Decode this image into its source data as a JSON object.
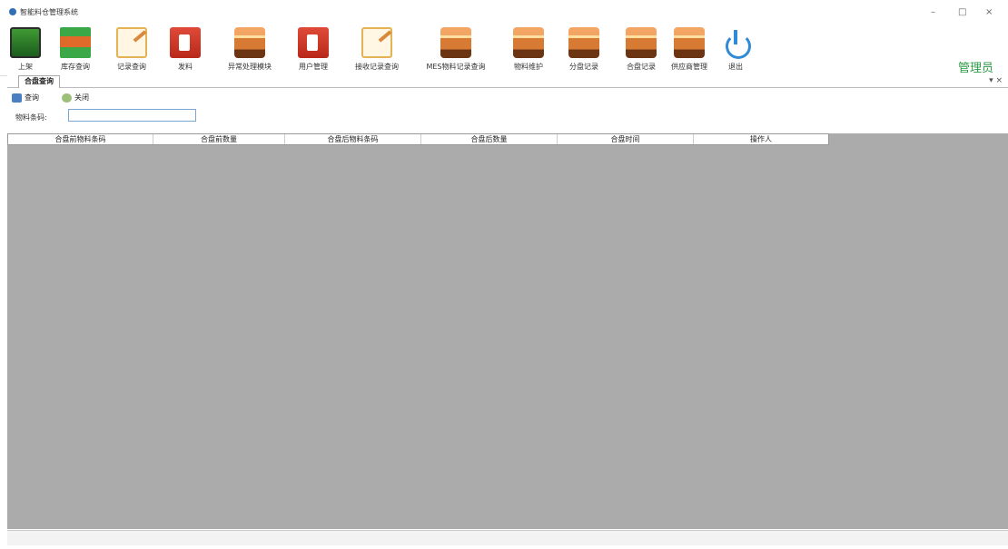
{
  "window": {
    "title": "智能料仓管理系统",
    "minimize": "–",
    "maximize": "□",
    "close": "×"
  },
  "toolbar": {
    "buttons": [
      {
        "label": "上架",
        "icon": "upload-icon"
      },
      {
        "label": "库存查询",
        "icon": "inventory-icon"
      },
      {
        "label": "记录查询",
        "icon": "notepad-icon"
      },
      {
        "label": "发料",
        "icon": "issue-icon"
      },
      {
        "label": "异常处理模块",
        "icon": "box-icon"
      },
      {
        "label": "用户管理",
        "icon": "user-icon"
      },
      {
        "label": "接收记录查询",
        "icon": "notepad-icon"
      },
      {
        "label": "MES物料记录查询",
        "icon": "box-icon"
      },
      {
        "label": "物料维护",
        "icon": "box-icon"
      },
      {
        "label": "分盘记录",
        "icon": "box-icon"
      },
      {
        "label": "合盘记录",
        "icon": "box-icon"
      },
      {
        "label": "供应商管理",
        "icon": "box-icon"
      },
      {
        "label": "退出",
        "icon": "power-icon"
      }
    ],
    "user_label": "管理员"
  },
  "tabs": [
    {
      "label": "合盘查询",
      "active": true
    }
  ],
  "tab_close": "▾ ×",
  "query": {
    "search_label": "查询",
    "close_label": "关闭",
    "material_label": "物料条码:",
    "material_value": ""
  },
  "grid": {
    "columns": [
      "合盘前物料条码",
      "合盘前数量",
      "合盘后物料条码",
      "合盘后数量",
      "合盘时间",
      "操作人"
    ],
    "rows": []
  }
}
